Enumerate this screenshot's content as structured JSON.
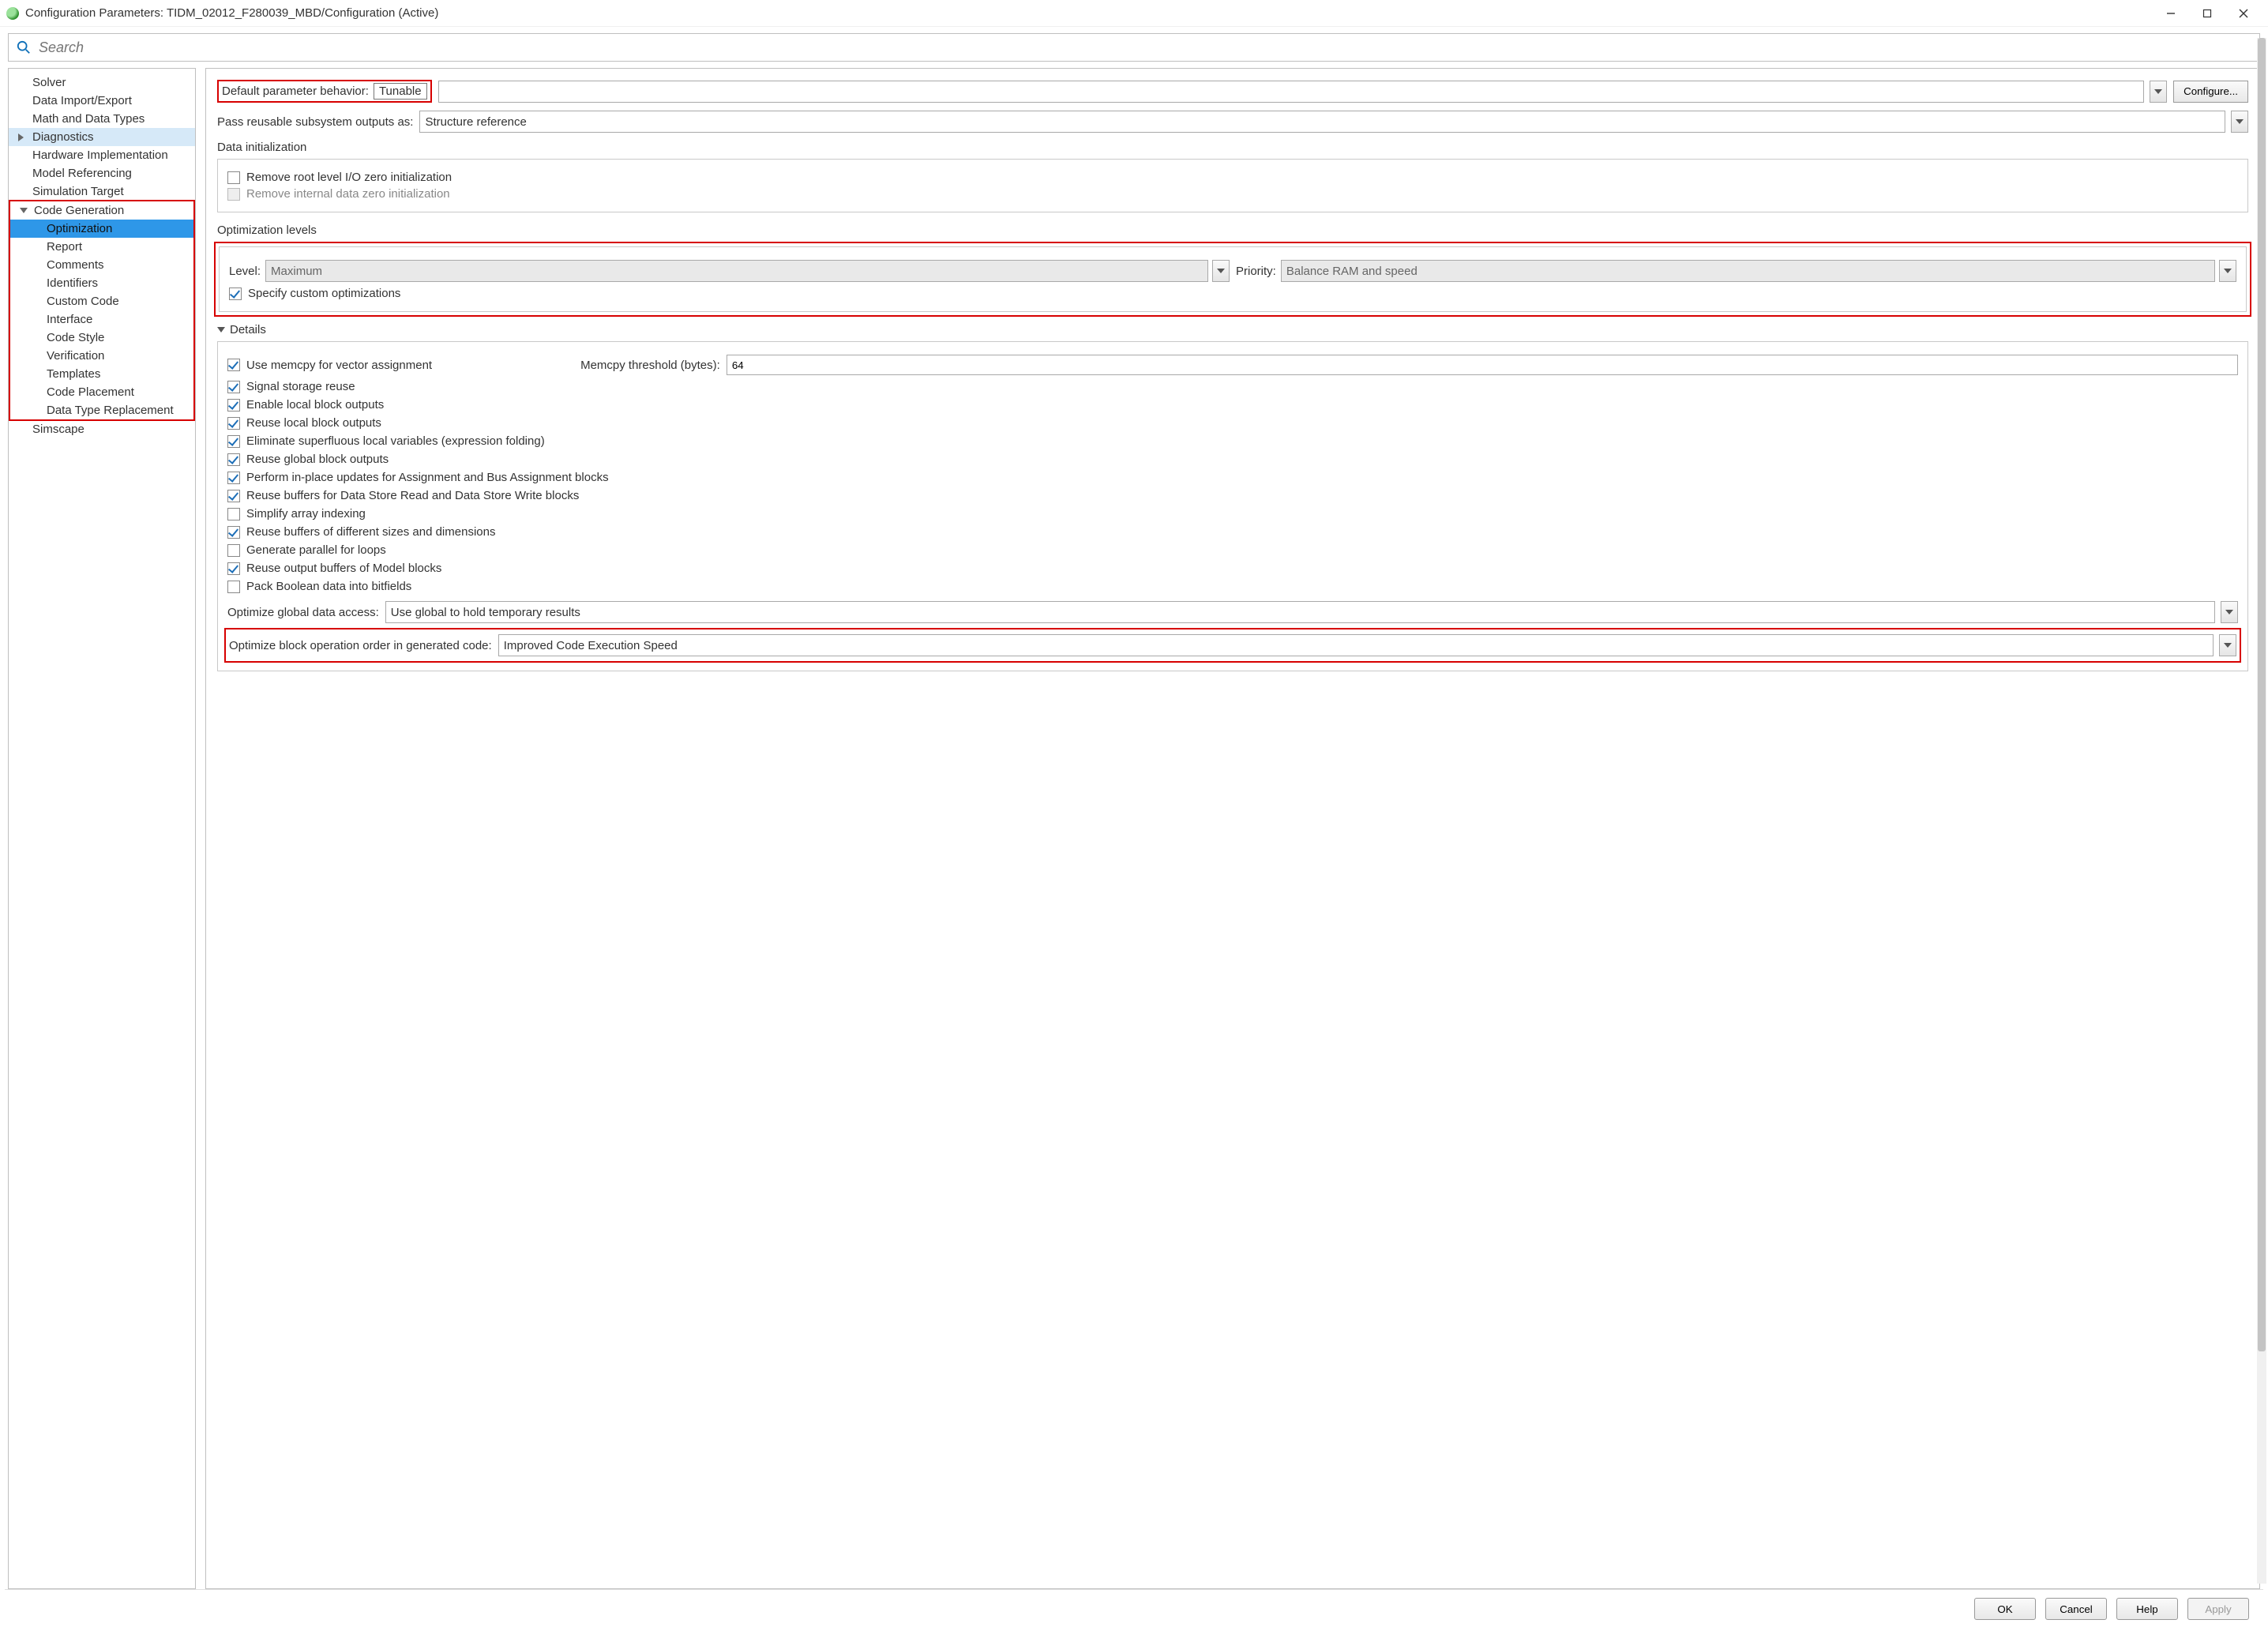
{
  "window": {
    "title": "Configuration Parameters: TIDM_02012_F280039_MBD/Configuration (Active)"
  },
  "search": {
    "placeholder": "Search"
  },
  "sidebar": {
    "items": [
      {
        "label": "Solver"
      },
      {
        "label": "Data Import/Export"
      },
      {
        "label": "Math and Data Types"
      },
      {
        "label": "Diagnostics"
      },
      {
        "label": "Hardware Implementation"
      },
      {
        "label": "Model Referencing"
      },
      {
        "label": "Simulation Target"
      },
      {
        "label": "Code Generation"
      },
      {
        "label": "Optimization"
      },
      {
        "label": "Report"
      },
      {
        "label": "Comments"
      },
      {
        "label": "Identifiers"
      },
      {
        "label": "Custom Code"
      },
      {
        "label": "Interface"
      },
      {
        "label": "Code Style"
      },
      {
        "label": "Verification"
      },
      {
        "label": "Templates"
      },
      {
        "label": "Code Placement"
      },
      {
        "label": "Data Type Replacement"
      },
      {
        "label": "Simscape"
      }
    ]
  },
  "main": {
    "default_param_label": "Default parameter behavior:",
    "default_param_value": "Tunable",
    "configure_btn": "Configure...",
    "pass_reuse_label": "Pass reusable subsystem outputs as:",
    "pass_reuse_value": "Structure reference",
    "data_init_title": "Data initialization",
    "data_init_opts": [
      {
        "label": "Remove root level I/O zero initialization",
        "checked": false,
        "disabled": false
      },
      {
        "label": "Remove internal data zero initialization",
        "checked": false,
        "disabled": true
      }
    ],
    "opt_levels_title": "Optimization levels",
    "level_label": "Level:",
    "level_value": "Maximum",
    "priority_label": "Priority:",
    "priority_value": "Balance RAM and speed",
    "specify_custom": "Specify custom optimizations",
    "details_title": "Details",
    "memcpy_label": "Memcpy threshold (bytes):",
    "memcpy_value": "64",
    "detail_opts": [
      {
        "label": "Use memcpy for vector assignment",
        "checked": true
      },
      {
        "label": "Signal storage reuse",
        "checked": true
      },
      {
        "label": "Enable local block outputs",
        "checked": true
      },
      {
        "label": "Reuse local block outputs",
        "checked": true
      },
      {
        "label": "Eliminate superfluous local variables (expression folding)",
        "checked": true
      },
      {
        "label": "Reuse global block outputs",
        "checked": true
      },
      {
        "label": "Perform in-place updates for Assignment and Bus Assignment blocks",
        "checked": true
      },
      {
        "label": "Reuse buffers for Data Store Read and Data Store Write blocks",
        "checked": true
      },
      {
        "label": "Simplify array indexing",
        "checked": false
      },
      {
        "label": "Reuse buffers of different sizes and dimensions",
        "checked": true
      },
      {
        "label": "Generate parallel for loops",
        "checked": false
      },
      {
        "label": "Reuse output buffers of Model blocks",
        "checked": true
      },
      {
        "label": "Pack Boolean data into bitfields",
        "checked": false
      }
    ],
    "opt_global_label": "Optimize global data access:",
    "opt_global_value": "Use global to hold temporary results",
    "opt_block_label": "Optimize block operation order in generated code:",
    "opt_block_value": "Improved Code Execution Speed"
  },
  "buttons": {
    "ok": "OK",
    "cancel": "Cancel",
    "help": "Help",
    "apply": "Apply"
  }
}
